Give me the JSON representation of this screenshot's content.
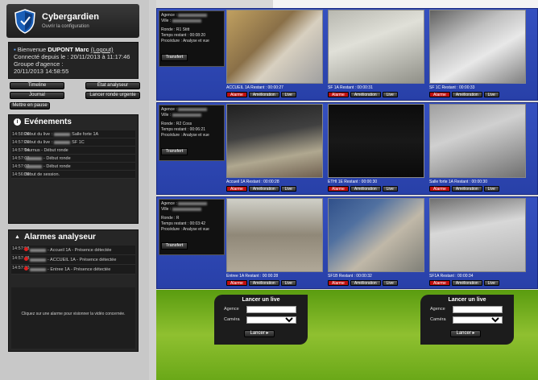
{
  "app": {
    "brand": "Cybergardien",
    "subtitle": "Ouvrir la configuration"
  },
  "user": {
    "welcome": "Bienvenue",
    "name": "DUPONT Marc",
    "logout": "(Logout)",
    "connected": "Connecté depuis le : 20/11/2013 à 11:17:46",
    "group": "Groupe d'agence :",
    "datetime": "20/11/2013 14:58:55"
  },
  "buttons": {
    "timeline": "Timeline",
    "etat": "Etat analyseur",
    "journal": "Journal",
    "lancer_ronde": "Lancer ronde urgente",
    "pause": "Mettre en pause"
  },
  "events": {
    "title": "Evénements",
    "items": [
      {
        "time": "14:58:26",
        "pre": "Début du live :",
        "post": "Salle forte 1A"
      },
      {
        "time": "14:57:21",
        "pre": "Début du live :",
        "post": "SF 1C"
      },
      {
        "time": "14:57:04",
        "pre": "Tournus - Début ronde",
        "post": ""
      },
      {
        "time": "14:57:03",
        "pre": "",
        "post": "- Début ronde"
      },
      {
        "time": "14:57:02",
        "pre": "",
        "post": "- Début ronde"
      },
      {
        "time": "14:56:39",
        "pre": "Début de session.",
        "post": ""
      }
    ]
  },
  "alarms": {
    "title": "Alarmes analyseur",
    "items": [
      {
        "time": "14:57:58",
        "text": "- Accueil 1A - Présence détectée"
      },
      {
        "time": "14:57:48",
        "text": "- ACCUEIL 1A - Présence détectée"
      },
      {
        "time": "14:57:30",
        "text": "- Entree 1A - Présence détectée"
      }
    ],
    "hint": "Cliquez sur une alarme pour visionner la vidéo concernée."
  },
  "rows": [
    {
      "agence": "Agence :",
      "ville": "Ville :",
      "ronde": "Ronde : R1 Stitt",
      "temps": "Temps restant : 00:08:20",
      "procedure": "Procédure : Analyse et vue",
      "transfer": "Transfert",
      "cams": [
        {
          "label": "ACCUEIL 1A Restant : 00:00:27"
        },
        {
          "label": "SF 1A Restant : 00:00:31"
        },
        {
          "label": "SF 1C Restant : 00:00:33"
        }
      ]
    },
    {
      "agence": "Agence :",
      "ville": "Ville :",
      "ronde": "Ronde : R2 Coss",
      "temps": "Temps restant : 00:06:21",
      "procedure": "Procédure : Analyse et vue",
      "transfer": "Transfert",
      "cams": [
        {
          "label": "Accueil 1A Restant : 00:00:28"
        },
        {
          "label": "ETHI 1E Restant : 00:00:30"
        },
        {
          "label": "Salle forte 1A Restant : 00:00:30"
        }
      ]
    },
    {
      "agence": "Agence :",
      "ville": "Ville :",
      "ronde": "Ronde : R",
      "temps": "Temps restant : 00:03:42",
      "procedure": "Procédure : Analyse et vue",
      "transfer": "Transfert",
      "cams": [
        {
          "label": "Entree 1A Restant : 00:00:28"
        },
        {
          "label": "SF1B Restant : 00:00:32"
        },
        {
          "label": "SF1A Restant : 00:00:34"
        }
      ]
    }
  ],
  "cam_buttons": {
    "alarme": "Alarme",
    "amelioration": "Amélioration",
    "live": "Live"
  },
  "launch": {
    "title": "Lancer un live",
    "agence": "Agence",
    "camera": "Caméra",
    "go": "Lancer ▸"
  },
  "colors": {
    "row_blue": "#2f48b8",
    "alarm_red": "#c01010",
    "green": "#8fc030"
  }
}
